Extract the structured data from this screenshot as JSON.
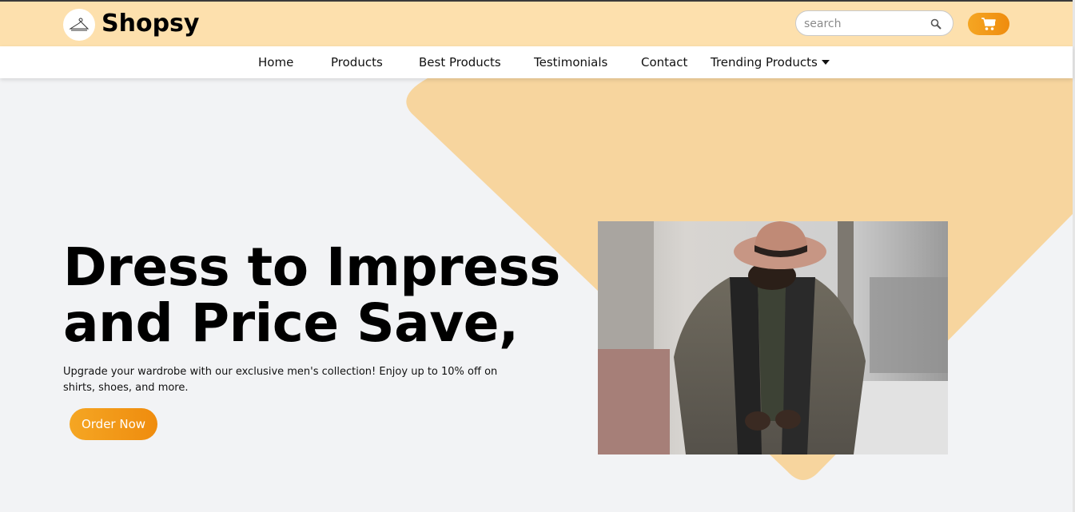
{
  "brand": {
    "name": "Shopsy",
    "logo_icon": "hanger-icon"
  },
  "search": {
    "placeholder": "search",
    "icon": "search-icon"
  },
  "cart": {
    "icon": "cart-icon"
  },
  "nav": {
    "items": [
      {
        "label": "Home"
      },
      {
        "label": "Products"
      },
      {
        "label": "Best Products"
      },
      {
        "label": "Testimonials"
      },
      {
        "label": "Contact"
      },
      {
        "label": "Trending Products",
        "icon": "caret-down-icon"
      }
    ]
  },
  "hero": {
    "headline_line1": "Dress to Impress",
    "headline_line2": "and Price Save,",
    "subtext": "Upgrade your wardrobe with our exclusive men's collection! Enjoy up to 10% off on shirts, shoes, and more.",
    "cta_label": "Order Now"
  },
  "colors": {
    "topbar": "#fde0ad",
    "accent": "#f5a623",
    "accent_dark": "#ef8c0e",
    "hero_shape": "#f7d59e",
    "page_bg": "#f2f3f5"
  }
}
